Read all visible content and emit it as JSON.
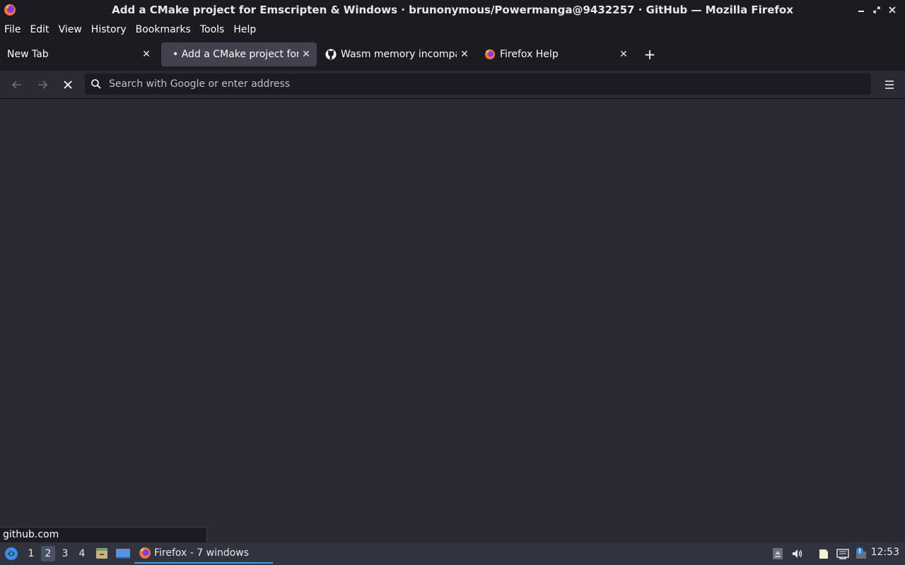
{
  "window": {
    "title": "Add a CMake project for Emscripten & Windows · brunonymous/Powermanga@9432257 · GitHub — Mozilla Firefox",
    "minimize_icon": "minimize-icon",
    "maximize_icon": "maximize-icon",
    "close_icon": "close-icon"
  },
  "menubar": {
    "file": "File",
    "edit": "Edit",
    "view": "View",
    "history": "History",
    "bookmarks": "Bookmarks",
    "tools": "Tools",
    "help": "Help"
  },
  "tabs": [
    {
      "label": "New Tab",
      "selected": false,
      "favicon": "none"
    },
    {
      "label": "• Add a CMake project for E",
      "selected": true,
      "favicon": "none"
    },
    {
      "label": "Wasm memory incompat",
      "selected": false,
      "favicon": "github-icon"
    },
    {
      "label": "Firefox Help",
      "selected": false,
      "favicon": "firefox-icon"
    }
  ],
  "navbar": {
    "url_placeholder": "Search with Google or enter address",
    "url_value": ""
  },
  "status": {
    "text": "github.com"
  },
  "taskbar": {
    "workspaces": [
      "1",
      "2",
      "3",
      "4"
    ],
    "active_workspace": "2",
    "task_label": "Firefox - 7 windows",
    "clock": "12:53"
  },
  "colors": {
    "chrome_dark": "#1c1b22",
    "content_bg": "#2b2a33",
    "selected_tab": "#42414d",
    "taskbar": "#2f343f",
    "accent": "#5294e2"
  }
}
